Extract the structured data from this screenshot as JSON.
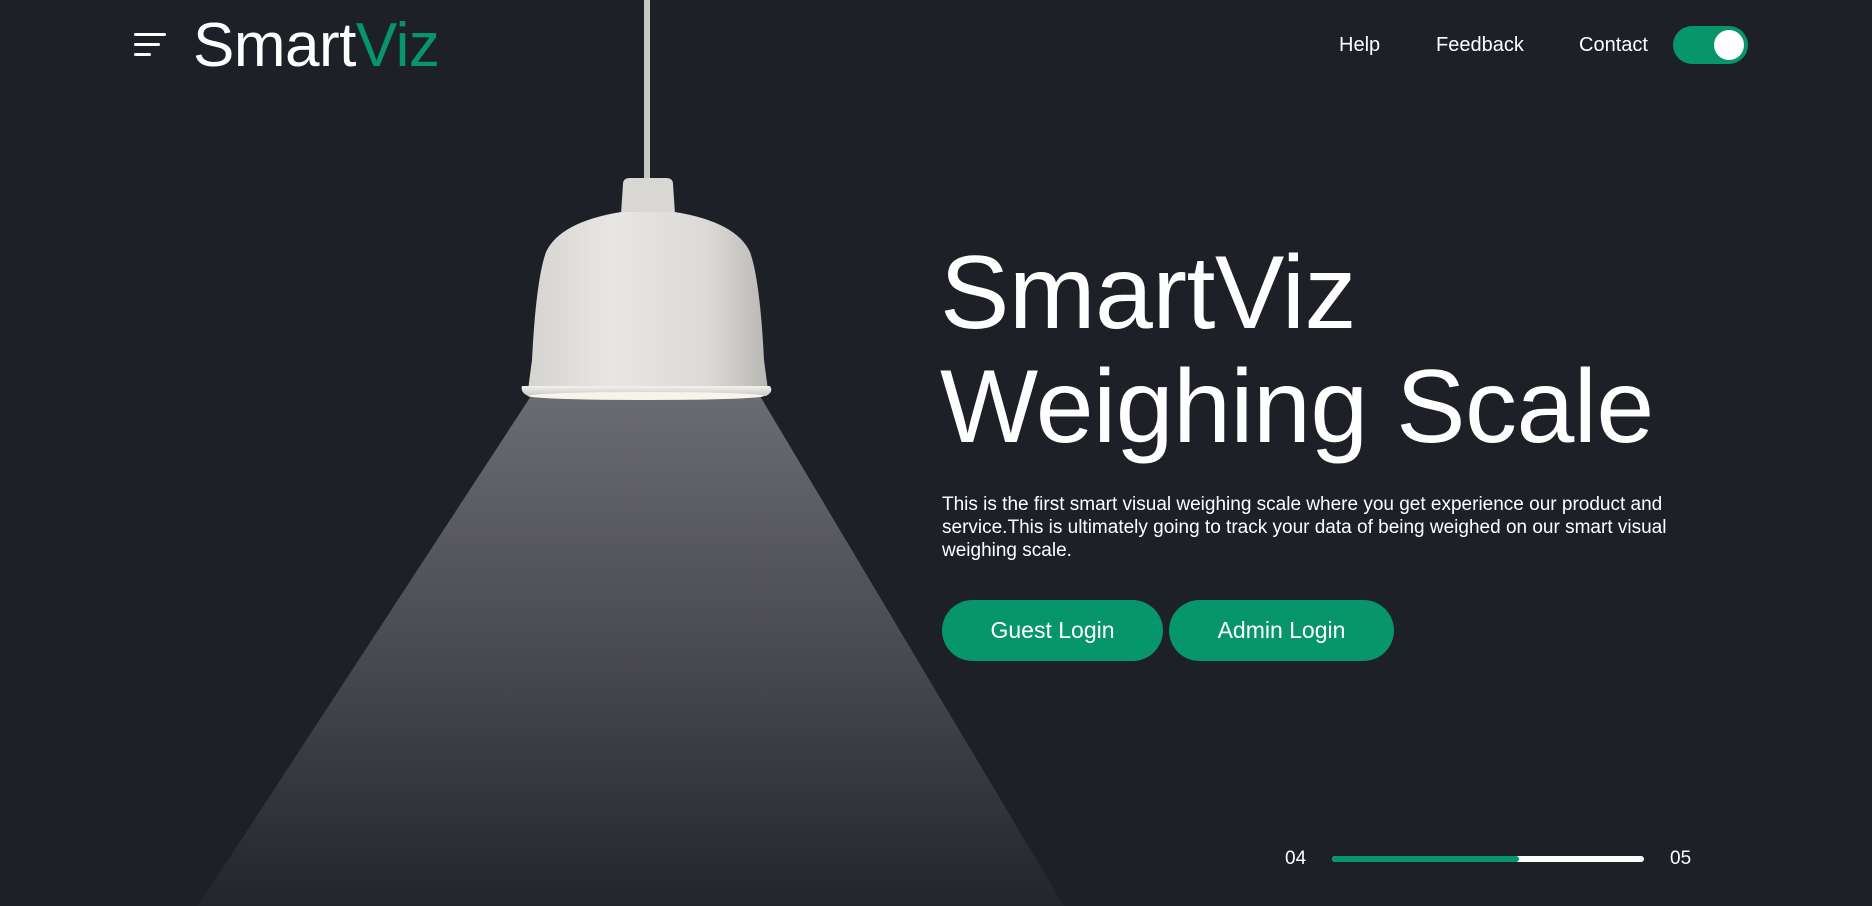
{
  "brand": {
    "logo_part1": "Smart",
    "logo_part2": "Viz",
    "accent_color": "#079669",
    "background_color": "#1e2027"
  },
  "header": {
    "menu_icon": "hamburger-menu-icon",
    "nav": [
      "Help",
      "Feedback",
      "Contact"
    ],
    "theme_toggle": {
      "state": "on"
    }
  },
  "hero": {
    "title_line1": "SmartViz",
    "title_line2": "Weighing Scale",
    "description": "This is the first smart visual weighing scale where you get experience our product and service.This is ultimately going to track your data of being weighed on our smart visual weighing scale.",
    "buttons": {
      "guest": "Guest Login",
      "admin": "Admin Login"
    },
    "image": "pendant-lamp-with-light-cone"
  },
  "slider": {
    "current": "04",
    "total": "05",
    "progress": 0.6
  }
}
